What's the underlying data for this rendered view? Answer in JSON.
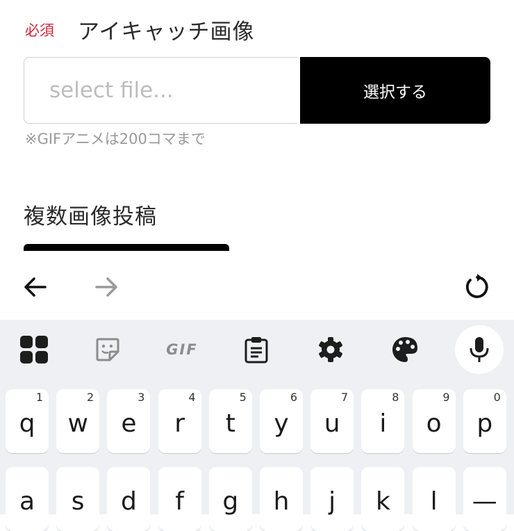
{
  "form": {
    "required_badge": "必須",
    "field_label": "アイキャッチ画像",
    "file_input_placeholder": "select file...",
    "select_button": "選択する",
    "note": "※GIFアニメは200コマまで",
    "section_title": "複数画像投稿"
  },
  "nav": {
    "back": "back-arrow-icon",
    "forward": "forward-arrow-icon",
    "reload": "reload-icon"
  },
  "keyboard": {
    "toolbar": [
      "apps-grid-icon",
      "sticker-icon",
      "gif-icon",
      "clipboard-icon",
      "settings-gear-icon",
      "palette-icon",
      "microphone-icon"
    ],
    "gif_label": "GIF",
    "row1": [
      {
        "key": "q",
        "hint": "1"
      },
      {
        "key": "w",
        "hint": "2"
      },
      {
        "key": "e",
        "hint": "3"
      },
      {
        "key": "r",
        "hint": "4"
      },
      {
        "key": "t",
        "hint": "5"
      },
      {
        "key": "y",
        "hint": "6"
      },
      {
        "key": "u",
        "hint": "7"
      },
      {
        "key": "i",
        "hint": "8"
      },
      {
        "key": "o",
        "hint": "9"
      },
      {
        "key": "p",
        "hint": "0"
      }
    ],
    "row2": [
      "a",
      "s",
      "d",
      "f",
      "g",
      "h",
      "j",
      "k",
      "l",
      "—"
    ]
  }
}
